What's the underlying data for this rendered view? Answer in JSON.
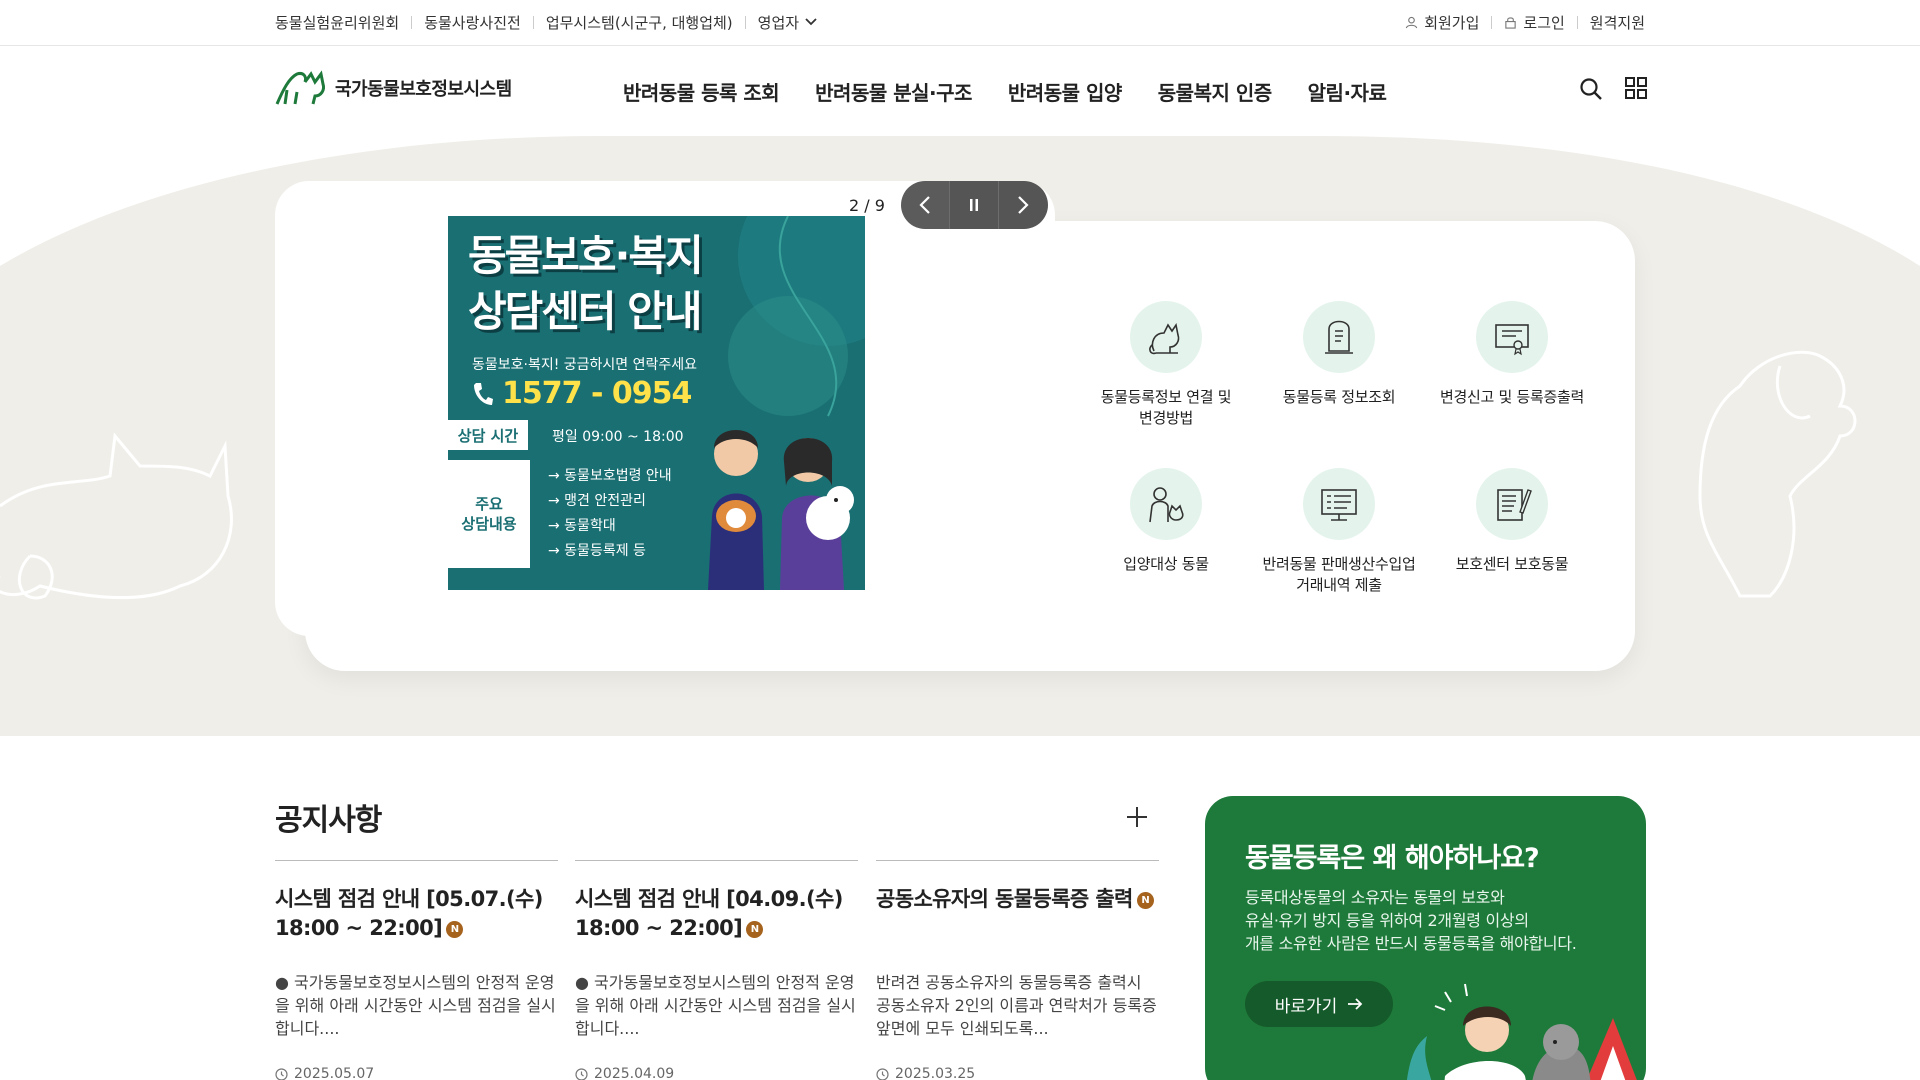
{
  "utility": {
    "left_links": [
      "동물실험윤리위원회",
      "동물사랑사진전",
      "업무시스템(시군구, 대행업체)",
      "영업자"
    ],
    "signup": "회원가입",
    "login": "로그인",
    "remote": "원격지원"
  },
  "header": {
    "logo_text": "국가동물보호정보시스템",
    "nav": [
      "반려동물 등록 조회",
      "반려동물 분실·구조",
      "반려동물 입양",
      "동물복지 인증",
      "알림·자료"
    ],
    "icons": [
      "search-icon",
      "grid-menu-icon"
    ]
  },
  "hero": {
    "slide_counter": "2 / 9",
    "banner": {
      "title_line1": "동물보호·복지",
      "title_line2": "상담센터 안내",
      "subtitle": "동물보호·복지! 궁금하시면 연락주세요",
      "phone": "1577 - 0954",
      "hours_tag": "상담 시간",
      "hours": "평일 09:00 ~ 18:00",
      "main_tag_line1": "주요",
      "main_tag_line2": "상담내용",
      "items": [
        "→ 동물보호법령 안내",
        "→ 맹견 안전관리",
        "→ 동물학대",
        "→ 동물등록제 등"
      ]
    },
    "quick_menu": [
      {
        "label": "동물등록정보 연결 및\n변경방법",
        "icon": "cat-icon"
      },
      {
        "label": "동물등록 정보조회",
        "icon": "tombstone-document-icon"
      },
      {
        "label": "변경신고 및 등록증출력",
        "icon": "certificate-icon"
      },
      {
        "label": "입양대상 동물",
        "icon": "person-with-dog-icon"
      },
      {
        "label": "반려동물 판매생산수입업\n거래내역 제출",
        "icon": "monitor-list-icon"
      },
      {
        "label": "보호센터 보호동물",
        "icon": "notepad-pen-icon"
      }
    ]
  },
  "notice": {
    "title": "공지사항",
    "badge": "N",
    "items": [
      {
        "title": "시스템 점검 안내 [05.07.(수) 18:00 ~ 22:00]",
        "body": "● 국가동물보호정보시스템의 안정적 운영을 위해 아래 시간동안 시스템 점검을 실시합니다....",
        "date": "2025.05.07"
      },
      {
        "title": "시스템 점검 안내 [04.09.(수) 18:00 ~ 22:00]",
        "body": "● 국가동물보호정보시스템의 안정적 운영을 위해 아래 시간동안 시스템 점검을 실시합니다....",
        "date": "2025.04.09"
      },
      {
        "title": "공동소유자의 동물등록증 출력",
        "body": "반려견 공동소유자의 동물등록증 출력시 공동소유자 2인의 이름과 연락처가 등록증 앞면에 모두 인쇄되도록...",
        "date": "2025.03.25"
      }
    ]
  },
  "promo": {
    "title": "동물등록은 왜 해야하나요?",
    "desc_line1": "등록대상동물의 소유자는 동물의 보호와",
    "desc_line2": "유실·유기 방지 등을 위하여 2개월령 이상의",
    "desc_line3": "개를 소유한 사람은 반드시 동물등록을 해야합니다.",
    "button": "바로가기"
  },
  "colors": {
    "brand_green": "#1e7a3a",
    "banner_teal": "#1a6f73",
    "badge_brown": "#a6631e",
    "hero_bg": "#efeee9",
    "icon_circle": "#e4f4ec"
  }
}
